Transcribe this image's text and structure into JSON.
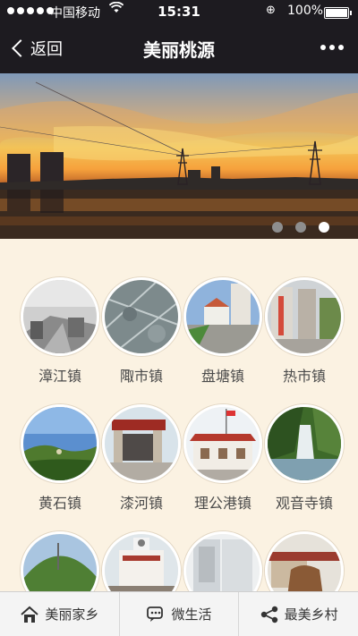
{
  "status_bar": {
    "carrier": "中国移动",
    "time": "15:31",
    "battery": "100%"
  },
  "nav": {
    "back_label": "返回",
    "title": "美丽桃源"
  },
  "banner": {
    "slide_count": 3,
    "active_slide": 3
  },
  "towns": [
    {
      "label": "漳江镇"
    },
    {
      "label": "陬市镇"
    },
    {
      "label": "盘塘镇"
    },
    {
      "label": "热市镇"
    },
    {
      "label": "黄石镇"
    },
    {
      "label": "漆河镇"
    },
    {
      "label": "理公港镇"
    },
    {
      "label": "观音寺镇"
    },
    {
      "label": ""
    },
    {
      "label": ""
    },
    {
      "label": ""
    },
    {
      "label": ""
    }
  ],
  "tabbar": {
    "items": [
      {
        "label": "美丽家乡",
        "icon": "house-icon"
      },
      {
        "label": "微生活",
        "icon": "chat-icon"
      },
      {
        "label": "最美乡村",
        "icon": "share-icon"
      }
    ]
  }
}
